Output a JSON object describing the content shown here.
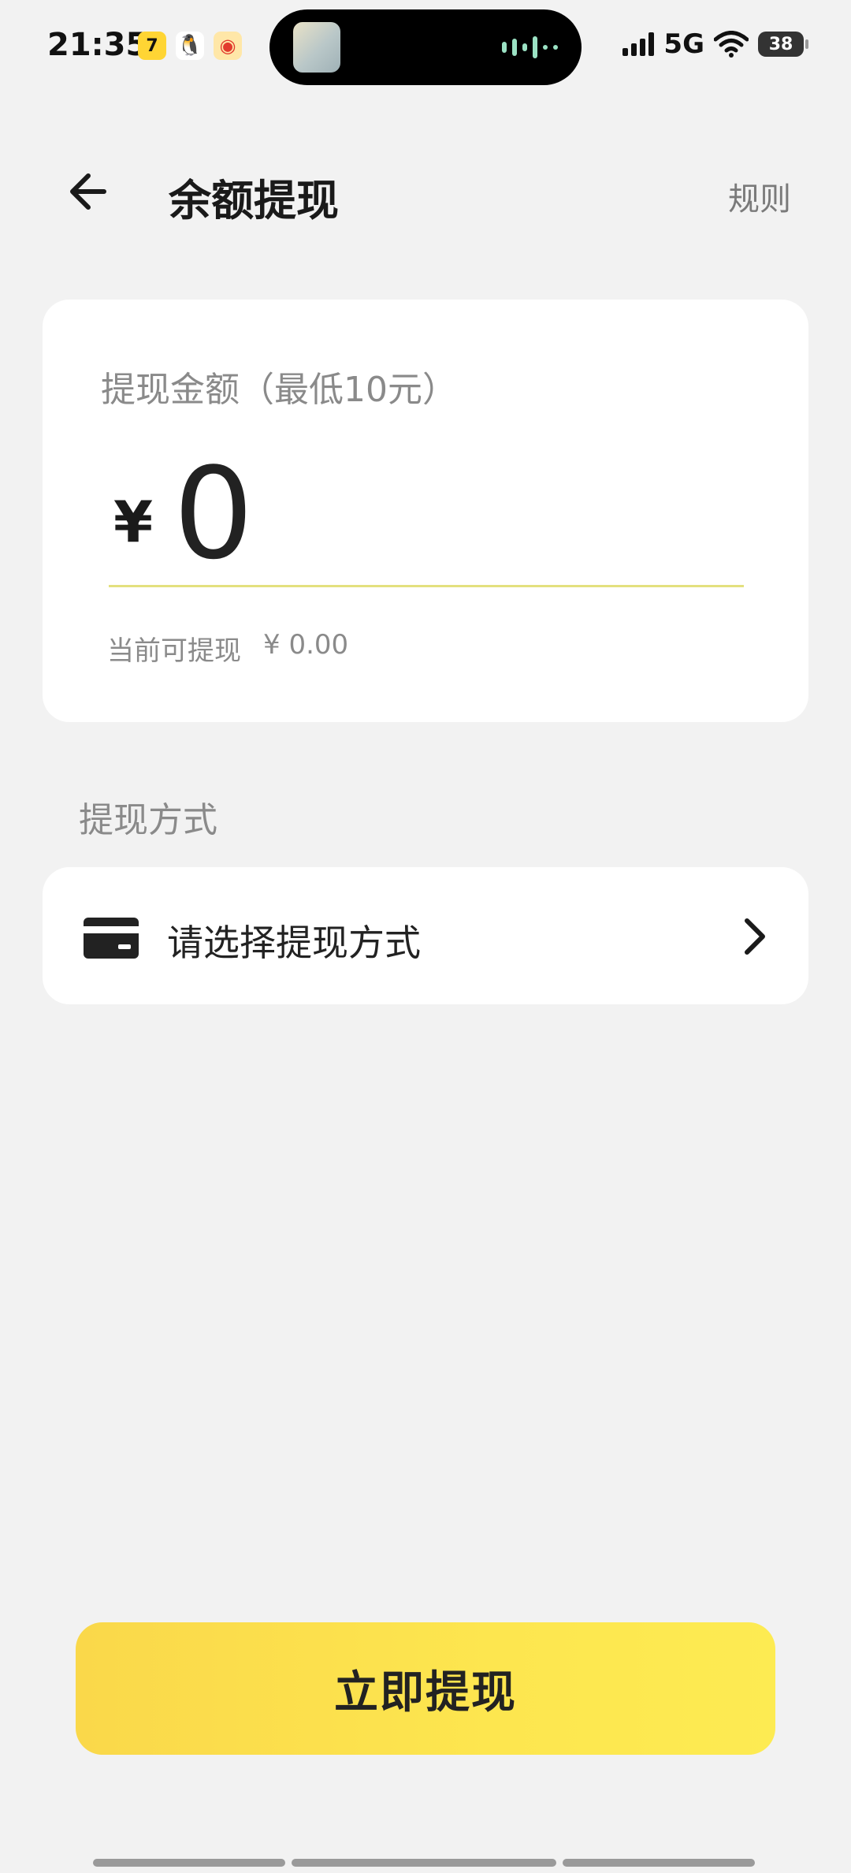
{
  "status_bar": {
    "time": "21:35",
    "notification_icons": [
      "7",
      "qq",
      "weibo"
    ],
    "network": "5G",
    "battery": "38"
  },
  "header": {
    "title": "余额提现",
    "rules_label": "规则"
  },
  "amount_card": {
    "label": "提现金额（最低10元）",
    "currency": "¥",
    "amount_value": "0",
    "available_label": "当前可提现",
    "available_amount": "¥ 0.00"
  },
  "method_section": {
    "title": "提现方式",
    "select_label": "请选择提现方式"
  },
  "action": {
    "withdraw_label": "立即提现"
  },
  "colors": {
    "accent_yellow": "#fce24e",
    "background": "#f2f2f2",
    "underline": "#e3e07e"
  }
}
